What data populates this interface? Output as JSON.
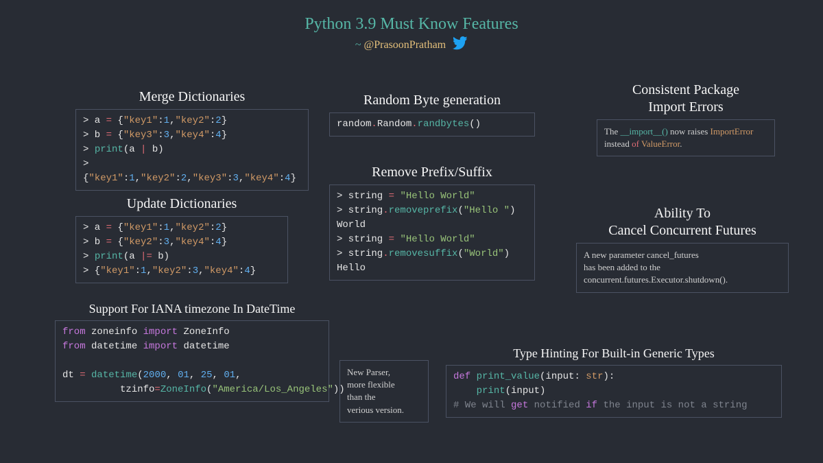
{
  "title": "Python 3.9 Must Know Features",
  "subtitle_tilde": "~",
  "subtitle_handle": "@PrasoonPratham",
  "sections": {
    "merge": {
      "title": "Merge Dictionaries",
      "lines": [
        "> a = {\"key1\":1,\"key2\":2}",
        "> b = {\"key3\":3,\"key4\":4}",
        "> print(a | b)",
        "> {\"key1\":1,\"key2\":2,\"key3\":3,\"key4\":4}"
      ]
    },
    "update": {
      "title": "Update Dictionaries",
      "lines": [
        "> a = {\"key1\":1,\"key2\":2}",
        "> b = {\"key2\":3,\"key4\":4}",
        "> print(a |= b)",
        "> {\"key1\":1,\"key2\":3,\"key4\":4}"
      ]
    },
    "iana": {
      "title": "Support For IANA timezone In DateTime",
      "lines": [
        "from zoneinfo import ZoneInfo",
        "from datetime import datetime",
        "",
        "dt = datetime(2000, 01, 25, 01,",
        "          tzinfo=ZoneInfo(\"America/Los_Angeles\"))"
      ]
    },
    "randbytes": {
      "title": "Random Byte generation",
      "code": "random.Random.randbytes()"
    },
    "prefix": {
      "title": "Remove Prefix/Suffix",
      "lines": [
        "> string = \"Hello World\"",
        "> string.removeprefix(\"Hello \")",
        "World",
        "> string = \"Hello World\"",
        "> string.removesuffix(\"World\")",
        "Hello"
      ]
    },
    "parser": {
      "text_l1": "New Parser,",
      "text_l2": "more flexible",
      "text_l3": "than the",
      "text_l4": "verious version."
    },
    "import_errors": {
      "title_l1": "Consistent Package",
      "title_l2": "Import Errors",
      "text_pre": "The ",
      "text_code": "__import__()",
      "text_mid": " now raises ",
      "text_err1": "ImportError",
      "text_instead": " instead ",
      "text_of": "of",
      "text_sp": " ",
      "text_err2": "ValueError",
      "text_dot": "."
    },
    "cancel": {
      "title_l1": "Ability To",
      "title_l2": "Cancel Concurrent Futures",
      "text_l1": "A new parameter cancel_futures",
      "text_l2": "has been added to the",
      "text_l3": "concurrent.futures.Executor.shutdown()."
    },
    "typehint": {
      "title": "Type Hinting For Built-in Generic Types",
      "lines": [
        "def print_value(input: str):",
        "    print(input)",
        "# We will get notified if the input is not a string"
      ]
    }
  }
}
